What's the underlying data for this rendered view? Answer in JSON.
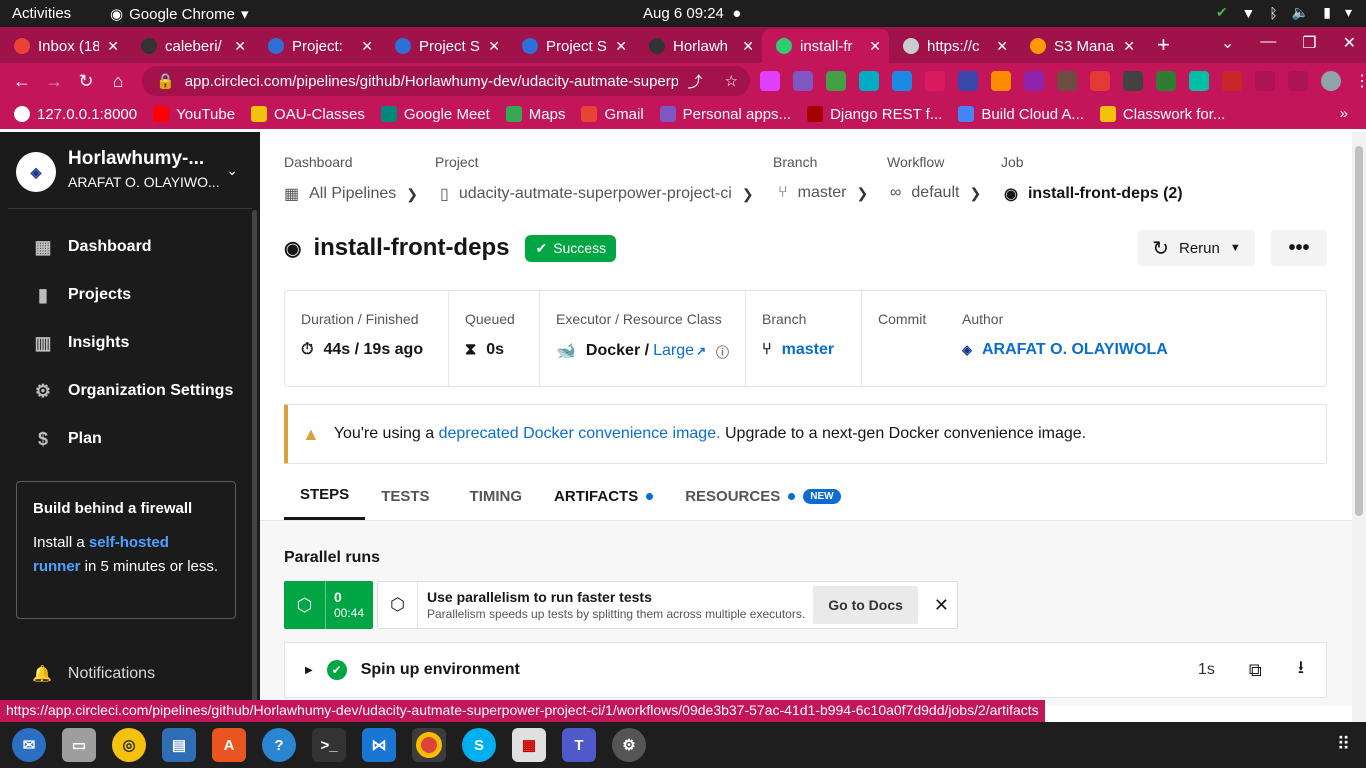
{
  "topbar": {
    "activities": "Activities",
    "app_name": "Google Chrome",
    "clock": "Aug 6  09:24"
  },
  "tabs": [
    {
      "title": "Inbox (18",
      "color": "#ea4335"
    },
    {
      "title": "caleberi/",
      "color": "#333333"
    },
    {
      "title": "Project: ",
      "color": "#2e6fd8"
    },
    {
      "title": "Project S",
      "color": "#2e6fd8"
    },
    {
      "title": "Project S",
      "color": "#2e6fd8"
    },
    {
      "title": "Horlawh",
      "color": "#333333"
    },
    {
      "title": "install-fr",
      "color": "#2ecc71"
    },
    {
      "title": "https://c",
      "color": "#cccccc"
    },
    {
      "title": "S3 Mana",
      "color": "#ff9900"
    }
  ],
  "address": {
    "url": "app.circleci.com/pipelines/github/Horlawhumy-dev/udacity-autmate-superpo..."
  },
  "bookmarks": [
    {
      "label": "127.0.0.1:8000",
      "color": "#ffffff"
    },
    {
      "label": "YouTube",
      "color": "#ff0000"
    },
    {
      "label": "OAU-Classes",
      "color": "#f4c20d"
    },
    {
      "label": "Google Meet",
      "color": "#00897b"
    },
    {
      "label": "Maps",
      "color": "#34a853"
    },
    {
      "label": "Gmail",
      "color": "#ea4335"
    },
    {
      "label": "Personal apps...",
      "color": "#7e57c2"
    },
    {
      "label": "Django REST f...",
      "color": "#a30000"
    },
    {
      "label": "Build Cloud A...",
      "color": "#4285f4"
    },
    {
      "label": "Classwork for...",
      "color": "#f4c20d"
    }
  ],
  "sidebar": {
    "org_name": "Horlawhumy-...",
    "org_user": "ARAFAT O. OLAYIWO...",
    "items": [
      {
        "label": "Dashboard"
      },
      {
        "label": "Projects"
      },
      {
        "label": "Insights"
      },
      {
        "label": "Organization Settings"
      },
      {
        "label": "Plan"
      }
    ],
    "firewall": {
      "title": "Build behind a firewall",
      "text_before": "Install a ",
      "link": "self-hosted runner",
      "text_after": " in 5 minutes or less."
    },
    "notifications": "Notifications"
  },
  "breadcrumb": {
    "labels": {
      "dashboard": "Dashboard",
      "project": "Project",
      "branch": "Branch",
      "workflow": "Workflow",
      "job": "Job"
    },
    "all_pipelines": "All Pipelines",
    "project": "udacity-autmate-superpower-project-ci",
    "branch": "master",
    "workflow": "default",
    "job": "install-front-deps (2)"
  },
  "job": {
    "title": "install-front-deps",
    "status": "Success",
    "rerun_label": "Rerun",
    "more_label": "•••"
  },
  "info": {
    "duration_label": "Duration / Finished",
    "duration_value": "44s / 19s ago",
    "queued_label": "Queued",
    "queued_value": "0s",
    "executor_label": "Executor / Resource Class",
    "executor_value": "Docker /",
    "resource_class": "Large",
    "branch_label": "Branch",
    "branch_value": "master",
    "commit_label": "Commit",
    "author_label": "Author",
    "author_value": "ARAFAT O. OLAYIWOLA"
  },
  "warning": {
    "prefix": "You're using a ",
    "link": "deprecated Docker convenience image.",
    "suffix": " Upgrade to a next-gen Docker convenience image."
  },
  "job_tabs": [
    {
      "label": "STEPS"
    },
    {
      "label": "TESTS"
    },
    {
      "label": "TIMING"
    },
    {
      "label": "ARTIFACTS"
    },
    {
      "label": "RESOURCES",
      "badge": "NEW"
    }
  ],
  "parallel": {
    "title": "Parallel runs",
    "run_index": "0",
    "run_time": "00:44",
    "promo_title": "Use parallelism to run faster tests",
    "promo_sub": "Parallelism speeds up tests by splitting them across multiple executors.",
    "docs_button": "Go to Docs"
  },
  "steps": [
    {
      "title": "Spin up environment",
      "duration": "1s"
    }
  ],
  "status_bubble": "https://app.circleci.com/pipelines/github/Horlawhumy-dev/udacity-autmate-superpower-project-ci/1/workflows/09de3b37-57ac-41d1-b994-6c10a0f7d9dd/jobs/2/artifacts",
  "colors": {
    "chrome_theme": "#c3165a",
    "success": "#00a644",
    "link": "#0a6ed1",
    "sidebar_bg": "#1b1b1b"
  }
}
